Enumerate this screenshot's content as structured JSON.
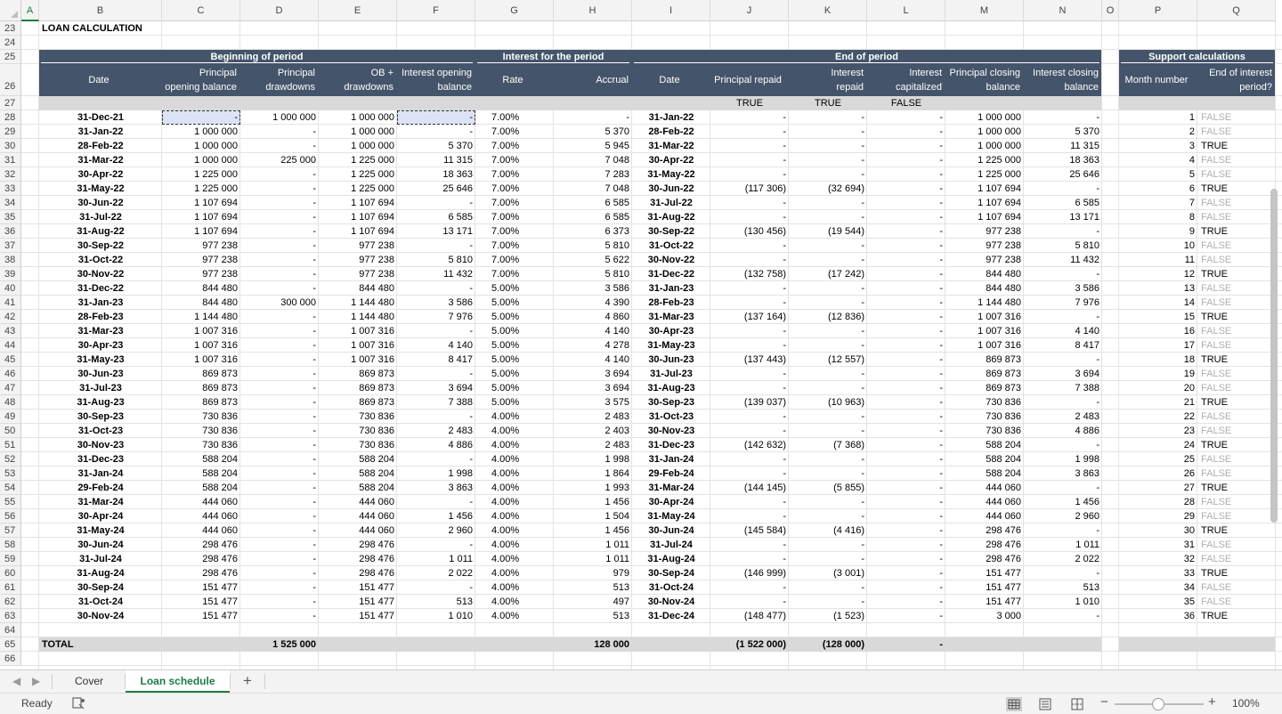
{
  "columns": [
    "A",
    "B",
    "C",
    "D",
    "E",
    "F",
    "G",
    "H",
    "I",
    "J",
    "K",
    "L",
    "M",
    "N",
    "O",
    "P",
    "Q"
  ],
  "selected_column": "A",
  "title": "LOAN CALCULATION",
  "groups": {
    "beginning": "Beginning of period",
    "interest": "Interest for the period",
    "end": "End of period",
    "support": "Support calculations"
  },
  "headers": {
    "B": [
      "Date"
    ],
    "C": [
      "Principal",
      "opening balance"
    ],
    "D": [
      "Principal",
      "drawdowns"
    ],
    "E": [
      "OB +",
      "drawdowns"
    ],
    "F": [
      "Interest opening",
      "balance"
    ],
    "G": [
      "Rate"
    ],
    "H": [
      "Accrual"
    ],
    "I": [
      "Date"
    ],
    "J": [
      "Principal repaid"
    ],
    "K": [
      "Interest",
      "repaid"
    ],
    "L": [
      "Interest",
      "capitalized"
    ],
    "M": [
      "Principal closing",
      "balance"
    ],
    "N": [
      "Interest closing",
      "balance"
    ],
    "P": [
      "Month number"
    ],
    "Q": [
      "End of interest",
      "period?"
    ]
  },
  "row27_flags": {
    "J": "TRUE",
    "K": "TRUE",
    "L": "FALSE"
  },
  "rows": [
    [
      "31-Dec-21",
      "-",
      "1 000 000",
      "1 000 000",
      "-",
      "7.00%",
      "-",
      "31-Jan-22",
      "-",
      "-",
      "-",
      "1 000 000",
      "-",
      "1",
      "FALSE"
    ],
    [
      "31-Jan-22",
      "1 000 000",
      "-",
      "1 000 000",
      "-",
      "7.00%",
      "5 370",
      "28-Feb-22",
      "-",
      "-",
      "-",
      "1 000 000",
      "5 370",
      "2",
      "FALSE"
    ],
    [
      "28-Feb-22",
      "1 000 000",
      "-",
      "1 000 000",
      "5 370",
      "7.00%",
      "5 945",
      "31-Mar-22",
      "-",
      "-",
      "-",
      "1 000 000",
      "11 315",
      "3",
      "TRUE"
    ],
    [
      "31-Mar-22",
      "1 000 000",
      "225 000",
      "1 225 000",
      "11 315",
      "7.00%",
      "7 048",
      "30-Apr-22",
      "-",
      "-",
      "-",
      "1 225 000",
      "18 363",
      "4",
      "FALSE"
    ],
    [
      "30-Apr-22",
      "1 225 000",
      "-",
      "1 225 000",
      "18 363",
      "7.00%",
      "7 283",
      "31-May-22",
      "-",
      "-",
      "-",
      "1 225 000",
      "25 646",
      "5",
      "FALSE"
    ],
    [
      "31-May-22",
      "1 225 000",
      "-",
      "1 225 000",
      "25 646",
      "7.00%",
      "7 048",
      "30-Jun-22",
      "(117 306)",
      "(32 694)",
      "-",
      "1 107 694",
      "-",
      "6",
      "TRUE"
    ],
    [
      "30-Jun-22",
      "1 107 694",
      "-",
      "1 107 694",
      "-",
      "7.00%",
      "6 585",
      "31-Jul-22",
      "-",
      "-",
      "-",
      "1 107 694",
      "6 585",
      "7",
      "FALSE"
    ],
    [
      "31-Jul-22",
      "1 107 694",
      "-",
      "1 107 694",
      "6 585",
      "7.00%",
      "6 585",
      "31-Aug-22",
      "-",
      "-",
      "-",
      "1 107 694",
      "13 171",
      "8",
      "FALSE"
    ],
    [
      "31-Aug-22",
      "1 107 694",
      "-",
      "1 107 694",
      "13 171",
      "7.00%",
      "6 373",
      "30-Sep-22",
      "(130 456)",
      "(19 544)",
      "-",
      "977 238",
      "-",
      "9",
      "TRUE"
    ],
    [
      "30-Sep-22",
      "977 238",
      "-",
      "977 238",
      "-",
      "7.00%",
      "5 810",
      "31-Oct-22",
      "-",
      "-",
      "-",
      "977 238",
      "5 810",
      "10",
      "FALSE"
    ],
    [
      "31-Oct-22",
      "977 238",
      "-",
      "977 238",
      "5 810",
      "7.00%",
      "5 622",
      "30-Nov-22",
      "-",
      "-",
      "-",
      "977 238",
      "11 432",
      "11",
      "FALSE"
    ],
    [
      "30-Nov-22",
      "977 238",
      "-",
      "977 238",
      "11 432",
      "7.00%",
      "5 810",
      "31-Dec-22",
      "(132 758)",
      "(17 242)",
      "-",
      "844 480",
      "-",
      "12",
      "TRUE"
    ],
    [
      "31-Dec-22",
      "844 480",
      "-",
      "844 480",
      "-",
      "5.00%",
      "3 586",
      "31-Jan-23",
      "-",
      "-",
      "-",
      "844 480",
      "3 586",
      "13",
      "FALSE"
    ],
    [
      "31-Jan-23",
      "844 480",
      "300 000",
      "1 144 480",
      "3 586",
      "5.00%",
      "4 390",
      "28-Feb-23",
      "-",
      "-",
      "-",
      "1 144 480",
      "7 976",
      "14",
      "FALSE"
    ],
    [
      "28-Feb-23",
      "1 144 480",
      "-",
      "1 144 480",
      "7 976",
      "5.00%",
      "4 860",
      "31-Mar-23",
      "(137 164)",
      "(12 836)",
      "-",
      "1 007 316",
      "-",
      "15",
      "TRUE"
    ],
    [
      "31-Mar-23",
      "1 007 316",
      "-",
      "1 007 316",
      "-",
      "5.00%",
      "4 140",
      "30-Apr-23",
      "-",
      "-",
      "-",
      "1 007 316",
      "4 140",
      "16",
      "FALSE"
    ],
    [
      "30-Apr-23",
      "1 007 316",
      "-",
      "1 007 316",
      "4 140",
      "5.00%",
      "4 278",
      "31-May-23",
      "-",
      "-",
      "-",
      "1 007 316",
      "8 417",
      "17",
      "FALSE"
    ],
    [
      "31-May-23",
      "1 007 316",
      "-",
      "1 007 316",
      "8 417",
      "5.00%",
      "4 140",
      "30-Jun-23",
      "(137 443)",
      "(12 557)",
      "-",
      "869 873",
      "-",
      "18",
      "TRUE"
    ],
    [
      "30-Jun-23",
      "869 873",
      "-",
      "869 873",
      "-",
      "5.00%",
      "3 694",
      "31-Jul-23",
      "-",
      "-",
      "-",
      "869 873",
      "3 694",
      "19",
      "FALSE"
    ],
    [
      "31-Jul-23",
      "869 873",
      "-",
      "869 873",
      "3 694",
      "5.00%",
      "3 694",
      "31-Aug-23",
      "-",
      "-",
      "-",
      "869 873",
      "7 388",
      "20",
      "FALSE"
    ],
    [
      "31-Aug-23",
      "869 873",
      "-",
      "869 873",
      "7 388",
      "5.00%",
      "3 575",
      "30-Sep-23",
      "(139 037)",
      "(10 963)",
      "-",
      "730 836",
      "-",
      "21",
      "TRUE"
    ],
    [
      "30-Sep-23",
      "730 836",
      "-",
      "730 836",
      "-",
      "4.00%",
      "2 483",
      "31-Oct-23",
      "-",
      "-",
      "-",
      "730 836",
      "2 483",
      "22",
      "FALSE"
    ],
    [
      "31-Oct-23",
      "730 836",
      "-",
      "730 836",
      "2 483",
      "4.00%",
      "2 403",
      "30-Nov-23",
      "-",
      "-",
      "-",
      "730 836",
      "4 886",
      "23",
      "FALSE"
    ],
    [
      "30-Nov-23",
      "730 836",
      "-",
      "730 836",
      "4 886",
      "4.00%",
      "2 483",
      "31-Dec-23",
      "(142 632)",
      "(7 368)",
      "-",
      "588 204",
      "-",
      "24",
      "TRUE"
    ],
    [
      "31-Dec-23",
      "588 204",
      "-",
      "588 204",
      "-",
      "4.00%",
      "1 998",
      "31-Jan-24",
      "-",
      "-",
      "-",
      "588 204",
      "1 998",
      "25",
      "FALSE"
    ],
    [
      "31-Jan-24",
      "588 204",
      "-",
      "588 204",
      "1 998",
      "4.00%",
      "1 864",
      "29-Feb-24",
      "-",
      "-",
      "-",
      "588 204",
      "3 863",
      "26",
      "FALSE"
    ],
    [
      "29-Feb-24",
      "588 204",
      "-",
      "588 204",
      "3 863",
      "4.00%",
      "1 993",
      "31-Mar-24",
      "(144 145)",
      "(5 855)",
      "-",
      "444 060",
      "-",
      "27",
      "TRUE"
    ],
    [
      "31-Mar-24",
      "444 060",
      "-",
      "444 060",
      "-",
      "4.00%",
      "1 456",
      "30-Apr-24",
      "-",
      "-",
      "-",
      "444 060",
      "1 456",
      "28",
      "FALSE"
    ],
    [
      "30-Apr-24",
      "444 060",
      "-",
      "444 060",
      "1 456",
      "4.00%",
      "1 504",
      "31-May-24",
      "-",
      "-",
      "-",
      "444 060",
      "2 960",
      "29",
      "FALSE"
    ],
    [
      "31-May-24",
      "444 060",
      "-",
      "444 060",
      "2 960",
      "4.00%",
      "1 456",
      "30-Jun-24",
      "(145 584)",
      "(4 416)",
      "-",
      "298 476",
      "-",
      "30",
      "TRUE"
    ],
    [
      "30-Jun-24",
      "298 476",
      "-",
      "298 476",
      "-",
      "4.00%",
      "1 011",
      "31-Jul-24",
      "-",
      "-",
      "-",
      "298 476",
      "1 011",
      "31",
      "FALSE"
    ],
    [
      "31-Jul-24",
      "298 476",
      "-",
      "298 476",
      "1 011",
      "4.00%",
      "1 011",
      "31-Aug-24",
      "-",
      "-",
      "-",
      "298 476",
      "2 022",
      "32",
      "FALSE"
    ],
    [
      "31-Aug-24",
      "298 476",
      "-",
      "298 476",
      "2 022",
      "4.00%",
      "979",
      "30-Sep-24",
      "(146 999)",
      "(3 001)",
      "-",
      "151 477",
      "-",
      "33",
      "TRUE"
    ],
    [
      "30-Sep-24",
      "151 477",
      "-",
      "151 477",
      "-",
      "4.00%",
      "513",
      "31-Oct-24",
      "-",
      "-",
      "-",
      "151 477",
      "513",
      "34",
      "FALSE"
    ],
    [
      "31-Oct-24",
      "151 477",
      "-",
      "151 477",
      "513",
      "4.00%",
      "497",
      "30-Nov-24",
      "-",
      "-",
      "-",
      "151 477",
      "1 010",
      "35",
      "FALSE"
    ],
    [
      "30-Nov-24",
      "151 477",
      "-",
      "151 477",
      "1 010",
      "4.00%",
      "513",
      "31-Dec-24",
      "(148 477)",
      "(1 523)",
      "-",
      "3 000",
      "-",
      "36",
      "TRUE"
    ]
  ],
  "total": {
    "label": "TOTAL",
    "D": "1 525 000",
    "H": "128 000",
    "J": "(1 522 000)",
    "K": "(128 000)",
    "L": "-"
  },
  "row_numbers": [
    "23",
    "24",
    "25",
    "26",
    "27",
    "28",
    "29",
    "30",
    "31",
    "32",
    "33",
    "34",
    "35",
    "36",
    "37",
    "38",
    "39",
    "40",
    "41",
    "42",
    "43",
    "44",
    "45",
    "46",
    "47",
    "48",
    "49",
    "50",
    "51",
    "52",
    "53",
    "54",
    "55",
    "56",
    "57",
    "58",
    "59",
    "60",
    "61",
    "62",
    "63",
    "64",
    "65",
    "66"
  ],
  "tabs": {
    "prev": "◀",
    "next": "▶",
    "items": [
      "Cover",
      "Loan schedule"
    ],
    "active": "Loan schedule",
    "add": "+"
  },
  "status": {
    "ready": "Ready",
    "zoom": "100%",
    "zoom_minus": "−",
    "zoom_plus": "+"
  },
  "colors": {
    "header_band": "#44546a",
    "accent": "#1d7a46",
    "grey_band": "#d9d9d9",
    "selection": "#dbe3f4"
  }
}
